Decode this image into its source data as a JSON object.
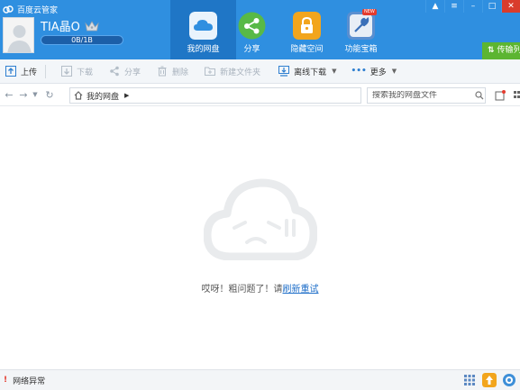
{
  "app": {
    "title": "百度云管家"
  },
  "user": {
    "name": "TIA晶O",
    "quota_text": "0B/1B",
    "quota_fraction": 0.0
  },
  "nav": {
    "tabs": [
      {
        "label": "我的网盘",
        "icon": "cloud-drive-icon",
        "active": true
      },
      {
        "label": "分享",
        "icon": "share-icon"
      },
      {
        "label": "隐藏空间",
        "icon": "lock-icon"
      },
      {
        "label": "功能宝箱",
        "icon": "toolbox-icon",
        "badge": "NEW"
      }
    ]
  },
  "window": {
    "transfer_label": "传输列"
  },
  "toolbar": {
    "upload": "上传",
    "download": "下载",
    "share": "分享",
    "delete": "删除",
    "new_folder": "新建文件夹",
    "offline_download": "离线下载",
    "more": "更多"
  },
  "address": {
    "breadcrumb_root": "我的网盘",
    "search_placeholder": "搜索我的网盘文件"
  },
  "main": {
    "error_text": "哎呀！粗问题了！请",
    "retry_link": "刷新重试"
  },
  "status": {
    "network_text": "网络异常"
  },
  "colors": {
    "header": "#2f8fe0",
    "active_tab": "#1f76c6",
    "transfer": "#5cb531",
    "link": "#1f6fc9"
  }
}
